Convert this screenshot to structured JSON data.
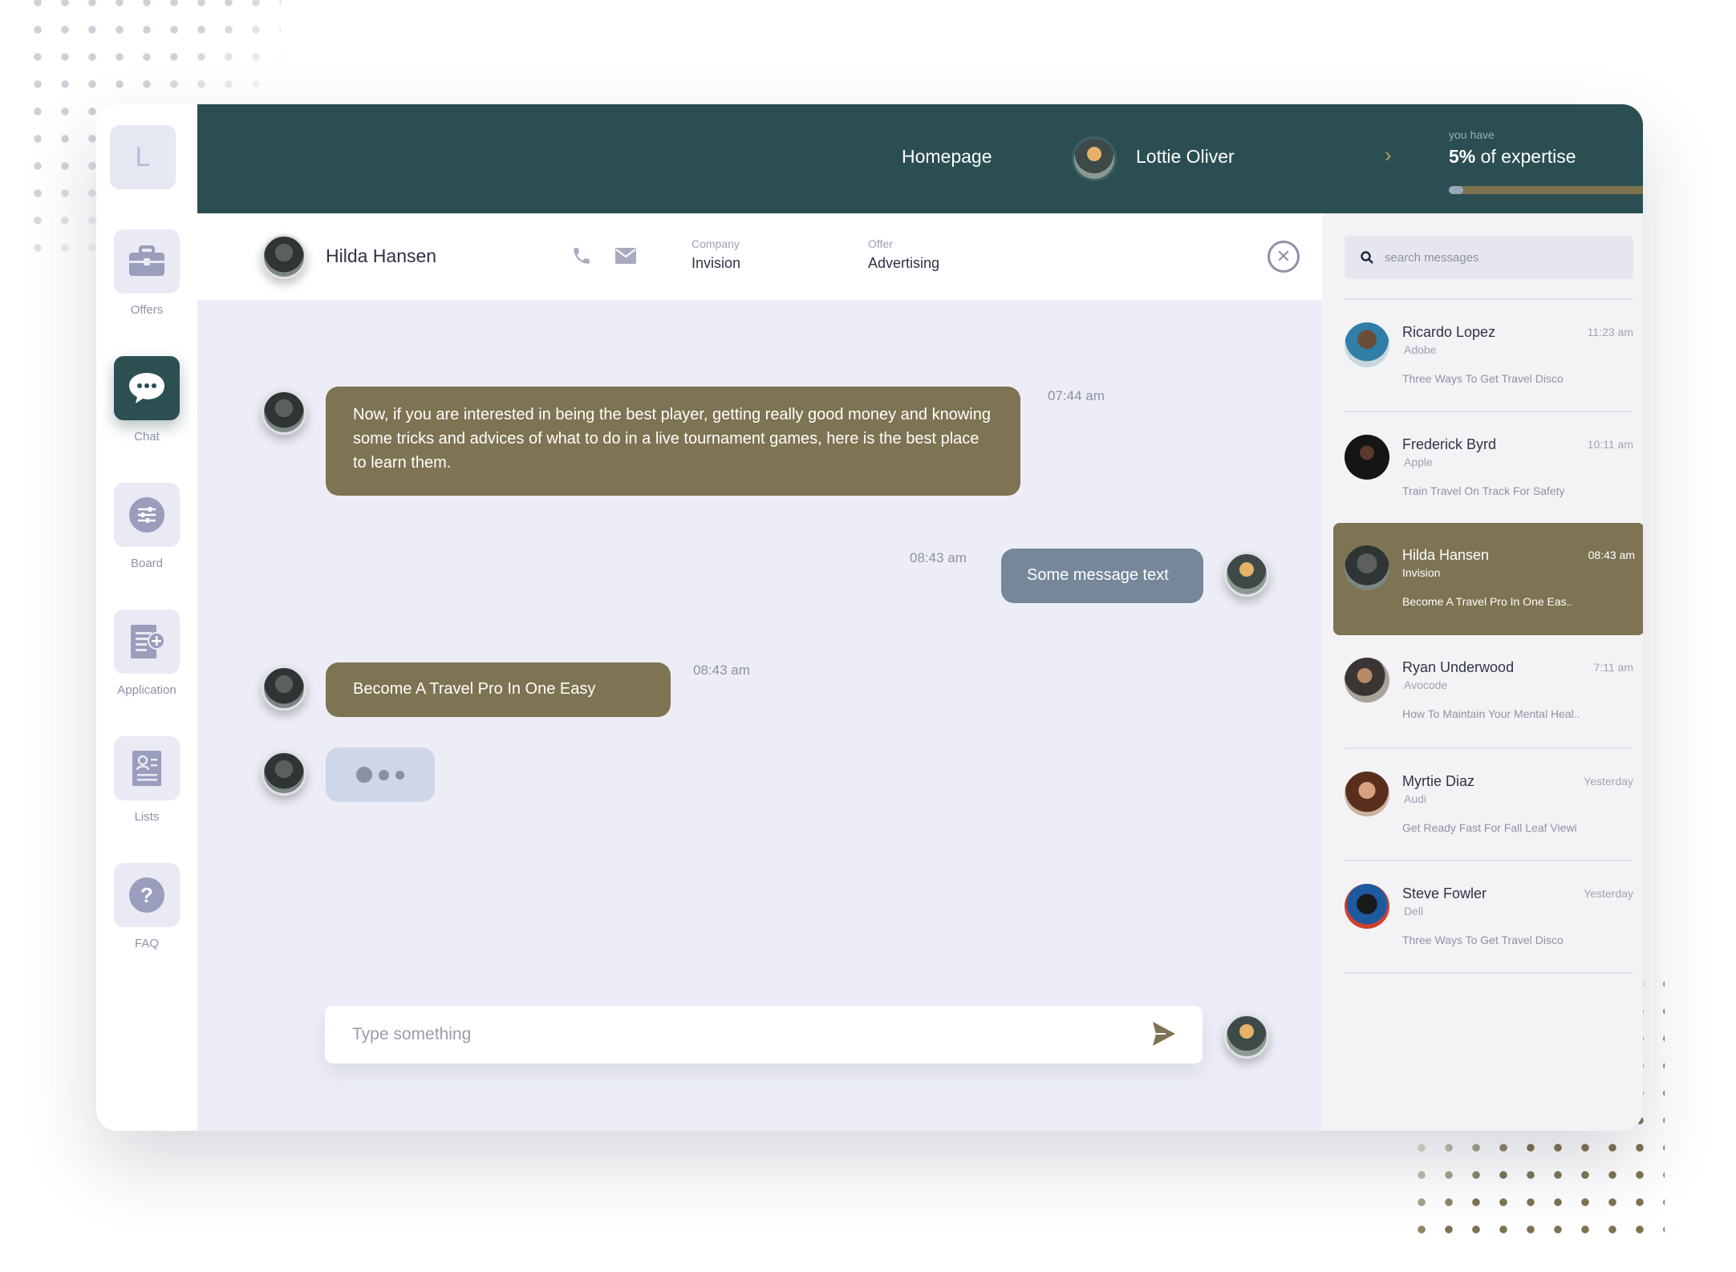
{
  "brand": {
    "logo_letter": "L"
  },
  "sidebar": {
    "items": [
      {
        "label": "Offers",
        "icon": "briefcase-icon"
      },
      {
        "label": "Chat",
        "icon": "chat-bubble-icon",
        "active": true
      },
      {
        "label": "Board",
        "icon": "sliders-icon"
      },
      {
        "label": "Application",
        "icon": "add-document-icon"
      },
      {
        "label": "Lists",
        "icon": "id-card-icon"
      },
      {
        "label": "FAQ",
        "icon": "help-icon"
      }
    ]
  },
  "topbar": {
    "homepage": "Homepage",
    "user_name": "Lottie Oliver",
    "expertise_caption": "you have",
    "expertise_value": "5%",
    "expertise_suffix": "of expertise",
    "expertise_progress": 0.05
  },
  "chat_header": {
    "name": "Hilda Hansen",
    "company_label": "Company",
    "company_value": "Invision",
    "offer_label": "Offer",
    "offer_value": "Advertising"
  },
  "messages": [
    {
      "from": "contact",
      "text": "Now, if you are interested in being the best player, getting really good money and knowing some tricks and advices of what to do in a live tournament games, here is the best place to learn them.",
      "time": "07:44 am"
    },
    {
      "from": "me",
      "text": "Some message text",
      "time": "08:43 am"
    },
    {
      "from": "contact",
      "text": "Become A Travel Pro In One Easy",
      "time": "08:43 am"
    }
  ],
  "composer": {
    "placeholder": "Type something"
  },
  "search": {
    "placeholder": "search messages"
  },
  "conversations": [
    {
      "name": "Ricardo Lopez",
      "company": "Adobe",
      "time": "11:23 am",
      "last": "Three Ways To Get Travel Disco"
    },
    {
      "name": "Frederick Byrd",
      "company": "Apple",
      "time": "10:11 am",
      "last": "Train Travel On Track For Safety"
    },
    {
      "name": "Hilda Hansen",
      "company": "Invision",
      "time": "08:43 am",
      "last": "Become A Travel Pro In One Eas..",
      "active": true
    },
    {
      "name": "Ryan Underwood",
      "company": "Avocode",
      "time": "7:11 am",
      "last": "How To Maintain Your Mental Heal.."
    },
    {
      "name": "Myrtie Diaz",
      "company": "Audi",
      "time": "Yesterday",
      "last": "Get Ready Fast For Fall Leaf Viewi"
    },
    {
      "name": "Steve Fowler",
      "company": "Dell",
      "time": "Yesterday",
      "last": "Three Ways To Get Travel Disco"
    }
  ],
  "colors": {
    "header_bg": "#2a4e52",
    "accent_olive": "#7e7352",
    "bubble_mine": "#76879a",
    "chat_bg": "#ecedf6"
  }
}
